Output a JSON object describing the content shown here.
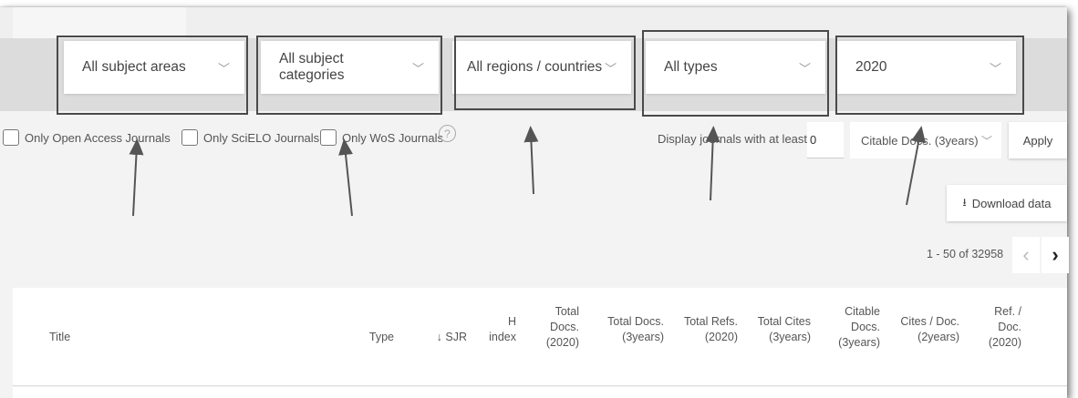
{
  "filters": {
    "dropdowns": [
      {
        "value": "All subject areas"
      },
      {
        "value": "All subject categories"
      },
      {
        "value": "All regions / countries"
      },
      {
        "value": "All types"
      },
      {
        "value": "2020"
      }
    ],
    "checkboxes": [
      {
        "label": "Only Open Access Journals",
        "checked": false
      },
      {
        "label": "Only SciELO Journals",
        "checked": false
      },
      {
        "label": "Only WoS Journals",
        "checked": false
      }
    ],
    "help_icon": "?",
    "min_label": "Display journals with at least",
    "min_value": "0",
    "citable_select": "Citable Docs. (3years)",
    "apply_label": "Apply",
    "download_label": "Download data"
  },
  "pager": {
    "range_text": "1 - 50 of 32958"
  },
  "table": {
    "columns": [
      {
        "key": "title",
        "label": "Title"
      },
      {
        "key": "type",
        "label": "Type"
      },
      {
        "key": "sjr",
        "label": "↓ SJR"
      },
      {
        "key": "h",
        "label": "H\nindex"
      },
      {
        "key": "total_docs",
        "label": "Total\nDocs.\n(2020)"
      },
      {
        "key": "total_docs_3y",
        "label": "Total Docs.\n(3years)"
      },
      {
        "key": "total_refs",
        "label": "Total Refs.\n(2020)"
      },
      {
        "key": "total_cites",
        "label": "Total Cites\n(3years)"
      },
      {
        "key": "citable_docs",
        "label": "Citable\nDocs.\n(3years)"
      },
      {
        "key": "cites_doc",
        "label": "Cites / Doc.\n(2years)"
      },
      {
        "key": "ref_doc",
        "label": "Ref. /\nDoc.\n(2020)"
      }
    ]
  },
  "icons": {
    "chevron_down": "chevron-down-icon",
    "download": "download-icon",
    "prev": "chevron-left-icon",
    "next": "chevron-right-icon"
  },
  "colors": {
    "annotation": "#555555",
    "filter_bar": "#dcdcdc"
  }
}
